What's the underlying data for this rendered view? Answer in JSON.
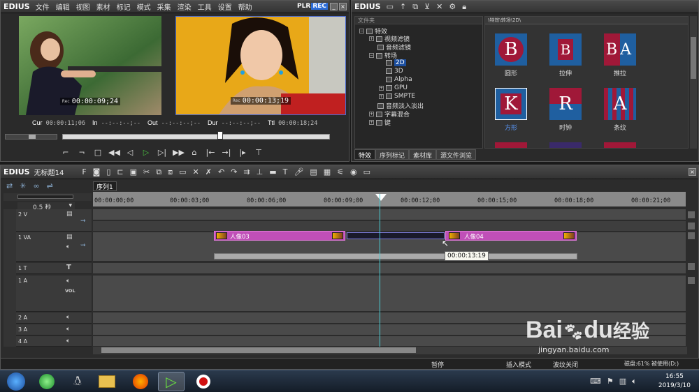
{
  "player": {
    "logo": "EDIUS",
    "menu": [
      "文件",
      "编辑",
      "视图",
      "素材",
      "标记",
      "模式",
      "采集",
      "渲染",
      "工具",
      "设置",
      "帮助"
    ],
    "plr": "PLR",
    "rec": "REC",
    "left_tc": "00:00:09;24",
    "right_tc": "00:00:13;19",
    "tc_tag": "Rec",
    "cur_label": "Cur",
    "cur_value": "00:00:11;06",
    "in_label": "In",
    "in_value": "--:--:--;--",
    "out_label": "Out",
    "out_value": "--:--:--;--",
    "dur_label": "Dur",
    "dur_value": "--:--:--;--",
    "ttl_label": "Ttl",
    "ttl_value": "00:00:18;24",
    "scrub_position": 0.59
  },
  "fx": {
    "logo": "EDIUS",
    "tree_header": "文件夹",
    "tree": [
      {
        "label": "特效",
        "level": 0
      },
      {
        "label": "视频滤镜",
        "level": 1
      },
      {
        "label": "音频滤镜",
        "level": 1
      },
      {
        "label": "转场",
        "level": 1
      },
      {
        "label": "2D",
        "level": 2,
        "selected": true
      },
      {
        "label": "3D",
        "level": 2
      },
      {
        "label": "Alpha",
        "level": 2
      },
      {
        "label": "GPU",
        "level": 2
      },
      {
        "label": "SMPTE",
        "level": 2
      },
      {
        "label": "音频淡入淡出",
        "level": 1
      },
      {
        "label": "字幕混合",
        "level": 1
      },
      {
        "label": "键",
        "level": 1
      }
    ],
    "path": "\\特效\\转场\\2D\\",
    "tiles": [
      {
        "label": "圆形",
        "glyph": "B"
      },
      {
        "label": "拉伸",
        "glyph": "B"
      },
      {
        "label": "推拉",
        "glyph": "BA"
      },
      {
        "label": "方形",
        "glyph": "K"
      },
      {
        "label": "时钟",
        "glyph": "R"
      },
      {
        "label": "条纹",
        "glyph": "A"
      }
    ],
    "tabs": [
      "特效",
      "序列标记",
      "素材库",
      "源文件浏览"
    ]
  },
  "timeline": {
    "logo": "EDIUS",
    "project": "无标题14",
    "sequence_tab": "序列1",
    "zoom": "0.5 秒",
    "ruler": [
      "00:00:00;00",
      "00:00:03;00",
      "00:00:06;00",
      "00:00:09;00",
      "00:00:12;00",
      "00:00:15;00",
      "00:00:18;00",
      "00:00:21;00"
    ],
    "tracks": [
      "2 V",
      "1 VA",
      "1 T",
      "1 A",
      "2 A",
      "3 A",
      "4 A"
    ],
    "vol_label": "VOL",
    "clip1_label": "人像03",
    "clip2_label": "人像04",
    "tooltip": "00:00:13:19",
    "status": [
      "暂停",
      "插入模式",
      "波纹关闭",
      "磁盘:61% 被使用(D:)"
    ]
  },
  "taskbar": {
    "time": "16:55",
    "date": "2019/3/10"
  },
  "watermark": {
    "brand": "Bai",
    "brand2": "du",
    "suffix": "经验",
    "url": "jingyan.baidu.com"
  }
}
